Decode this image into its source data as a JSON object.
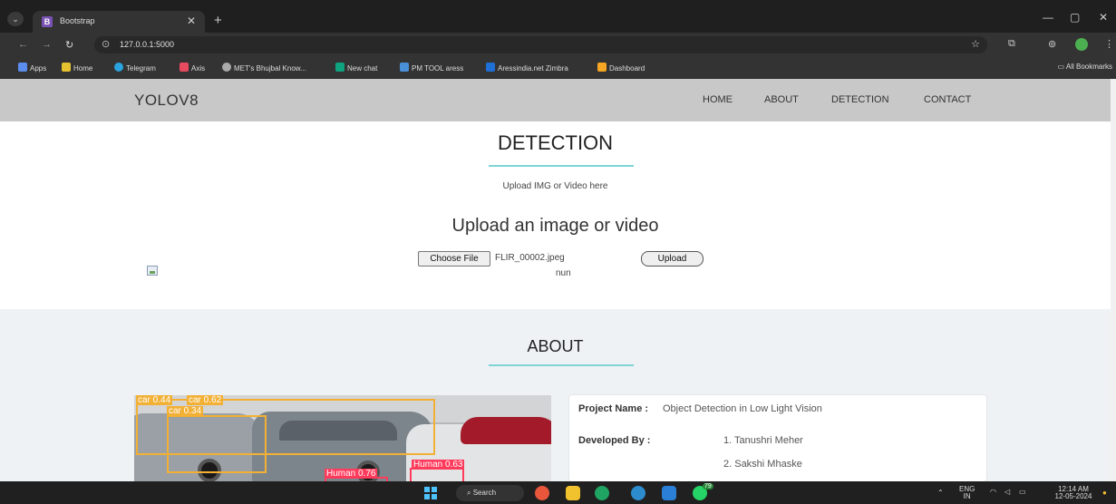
{
  "browser": {
    "tab_title": "Bootstrap",
    "tab_favicon": "B",
    "url": "127.0.0.1:5000",
    "bookmarks": [
      "Apps",
      "Home",
      "Telegram",
      "Axis",
      "MET's Bhujbal Know...",
      "New chat",
      "PM TOOL aress",
      "Aressindia.net Zimbra",
      "Dashboard"
    ],
    "all_bookmarks": "All Bookmarks"
  },
  "navbar": {
    "brand": "YOLOV8",
    "links": [
      "HOME",
      "ABOUT",
      "DETECTION",
      "CONTACT"
    ]
  },
  "detection": {
    "title": "DETECTION",
    "subtitle": "Upload IMG or Video here",
    "heading": "Upload an image or video",
    "choose_file_label": "Choose File",
    "file_name": "FLIR_00002.jpeg",
    "upload_label": "Upload",
    "result_text": "nun"
  },
  "about": {
    "title": "ABOUT",
    "image_labels": [
      "car 0.44",
      "car 0.62",
      "car 0.34",
      "Human 0.63",
      "Human 0.76"
    ],
    "project_label": "Project Name :",
    "project_name": "Object Detection in Low Light Vision",
    "developed_label": "Developed By :",
    "developers": [
      "1. Tanushri Meher",
      "2. Sakshi Mhaske"
    ]
  },
  "taskbar": {
    "search_label": "Search",
    "lang": "ENG",
    "region": "IN",
    "time": "12:14 AM",
    "date": "12-05-2024",
    "badge_count": "79"
  },
  "colors": {
    "navbar_bg": "#c8c8c8",
    "divider": "#7fd3d6",
    "about_bg": "#eef2f4",
    "detect_car": "#f2b035",
    "detect_human": "#ff3b5c"
  }
}
